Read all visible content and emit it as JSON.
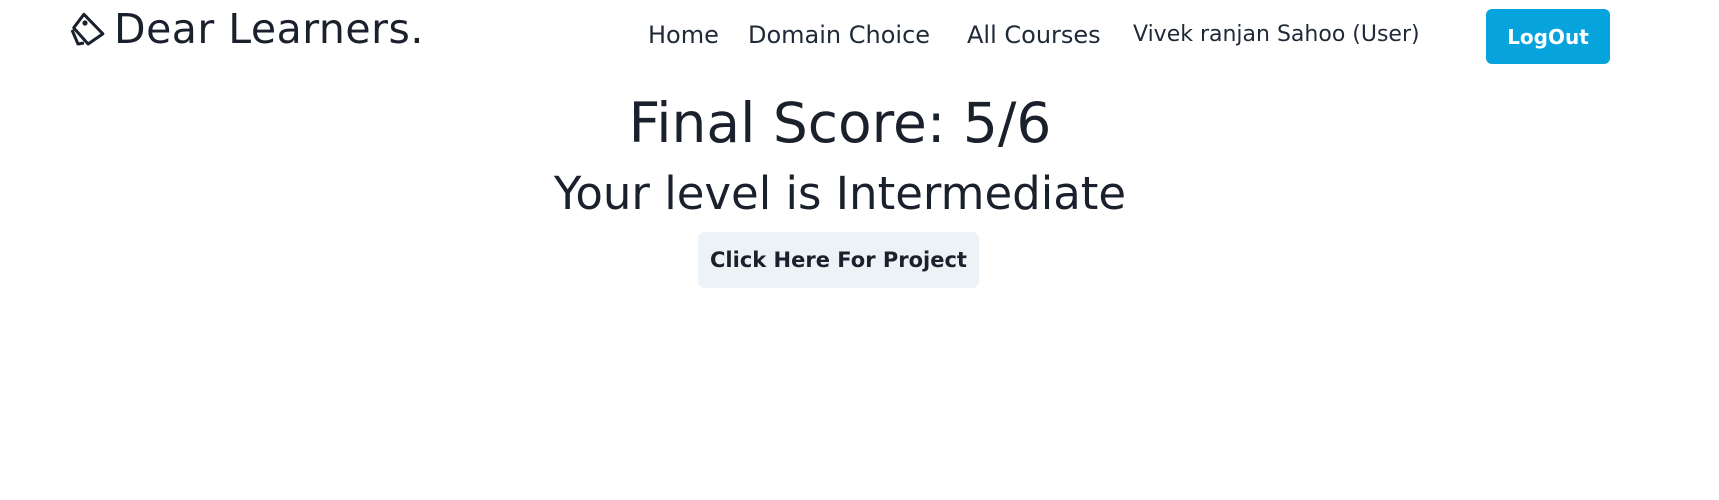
{
  "navbar": {
    "brand": {
      "icon": "tag-icon",
      "text": "Dear Learners."
    },
    "links": {
      "home": "Home",
      "domain_choice": "Domain Choice",
      "all_courses": "All Courses"
    },
    "user_label": "Vivek ranjan Sahoo (User)",
    "logout_label": "LogOut"
  },
  "main": {
    "final_score": "Final Score: 5/6",
    "level": "Your level is Intermediate",
    "project_button": "Click Here For Project"
  },
  "colors": {
    "logout_bg": "#06a3dc",
    "project_bg": "#edf2f7",
    "text": "#1a202c"
  }
}
